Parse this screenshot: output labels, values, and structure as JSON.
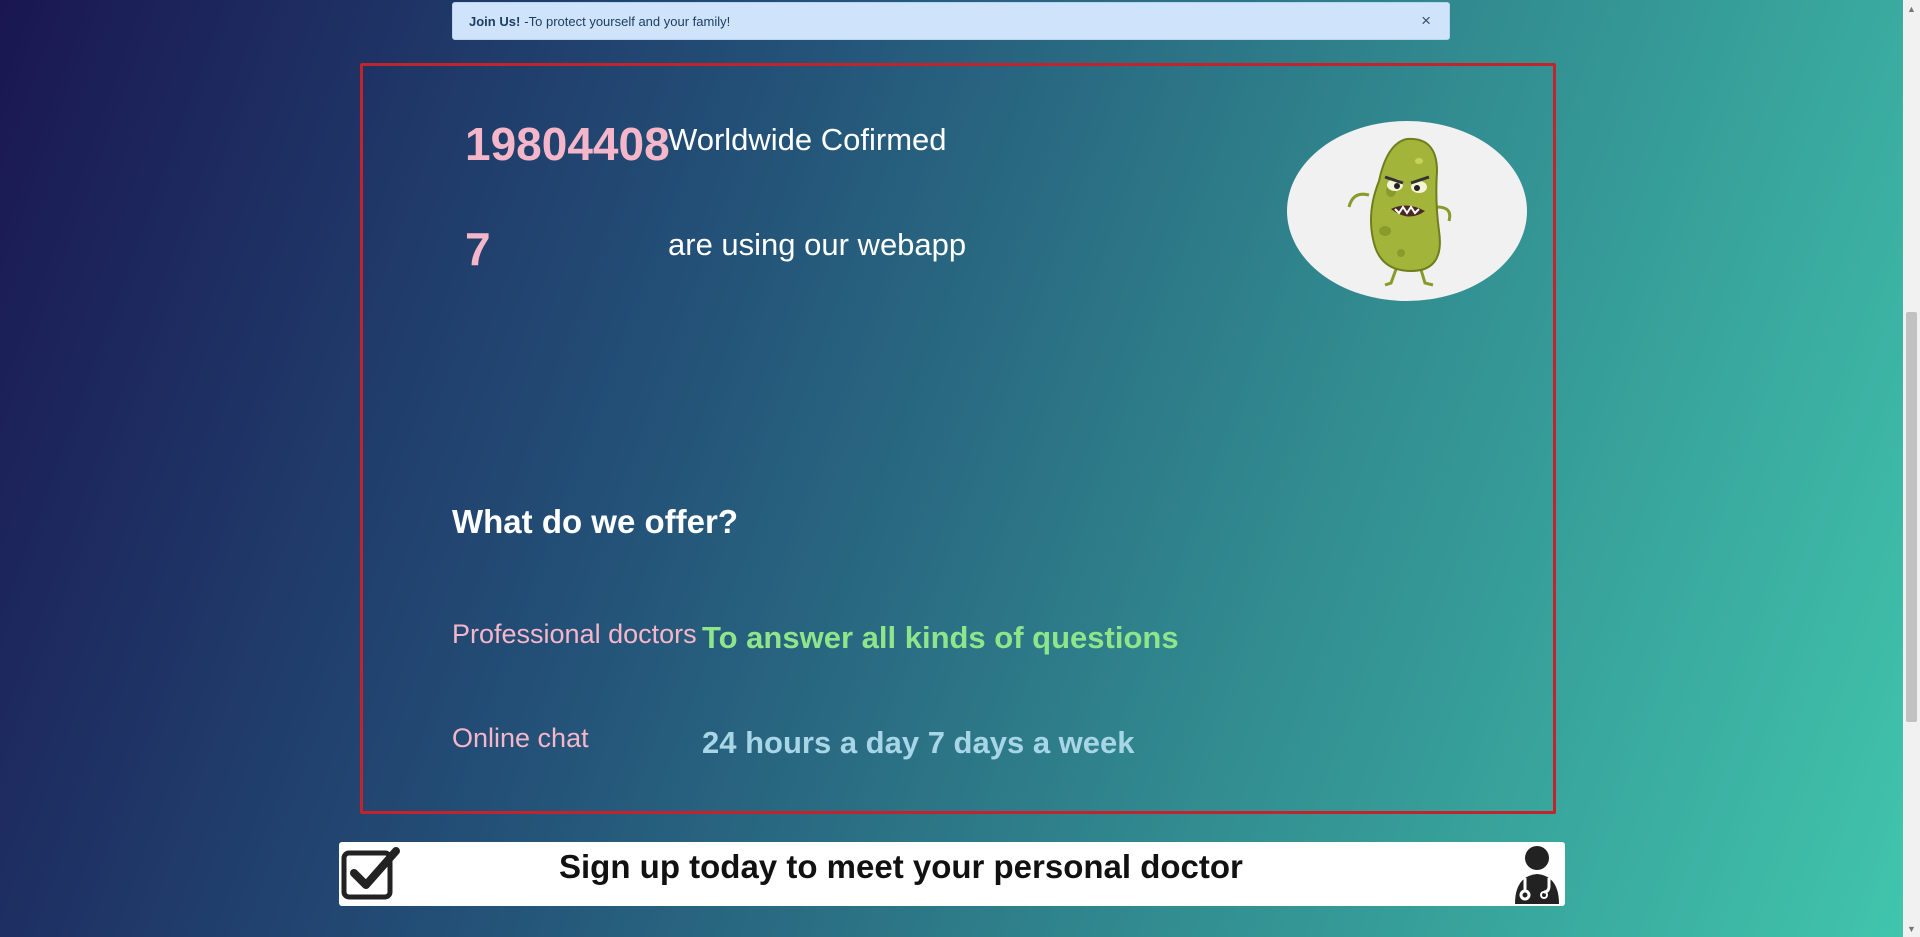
{
  "alert": {
    "bold": "Join Us!",
    "text": "-To protect yourself and your family!",
    "close": "×"
  },
  "stats": {
    "confirmed_value": "19804408",
    "confirmed_label": "Worldwide Cofirmed",
    "users_value": "7",
    "users_label": "are using our webapp"
  },
  "offer": {
    "title": "What do we offer?",
    "items": [
      {
        "label": "Professional doctors",
        "value": "To answer all kinds of questions",
        "color": "#8fe68a"
      },
      {
        "label": "Online chat",
        "value": "24 hours a day 7 days a week",
        "color": "#a8d6e6"
      }
    ]
  },
  "signup": {
    "text": "Sign up today to meet your personal doctor"
  },
  "colors": {
    "accent_pink": "#f6b6c9",
    "panel_border": "#c1242d"
  },
  "icons": [
    "close-icon",
    "virus-image",
    "checkbox-icon",
    "doctor-icon"
  ]
}
